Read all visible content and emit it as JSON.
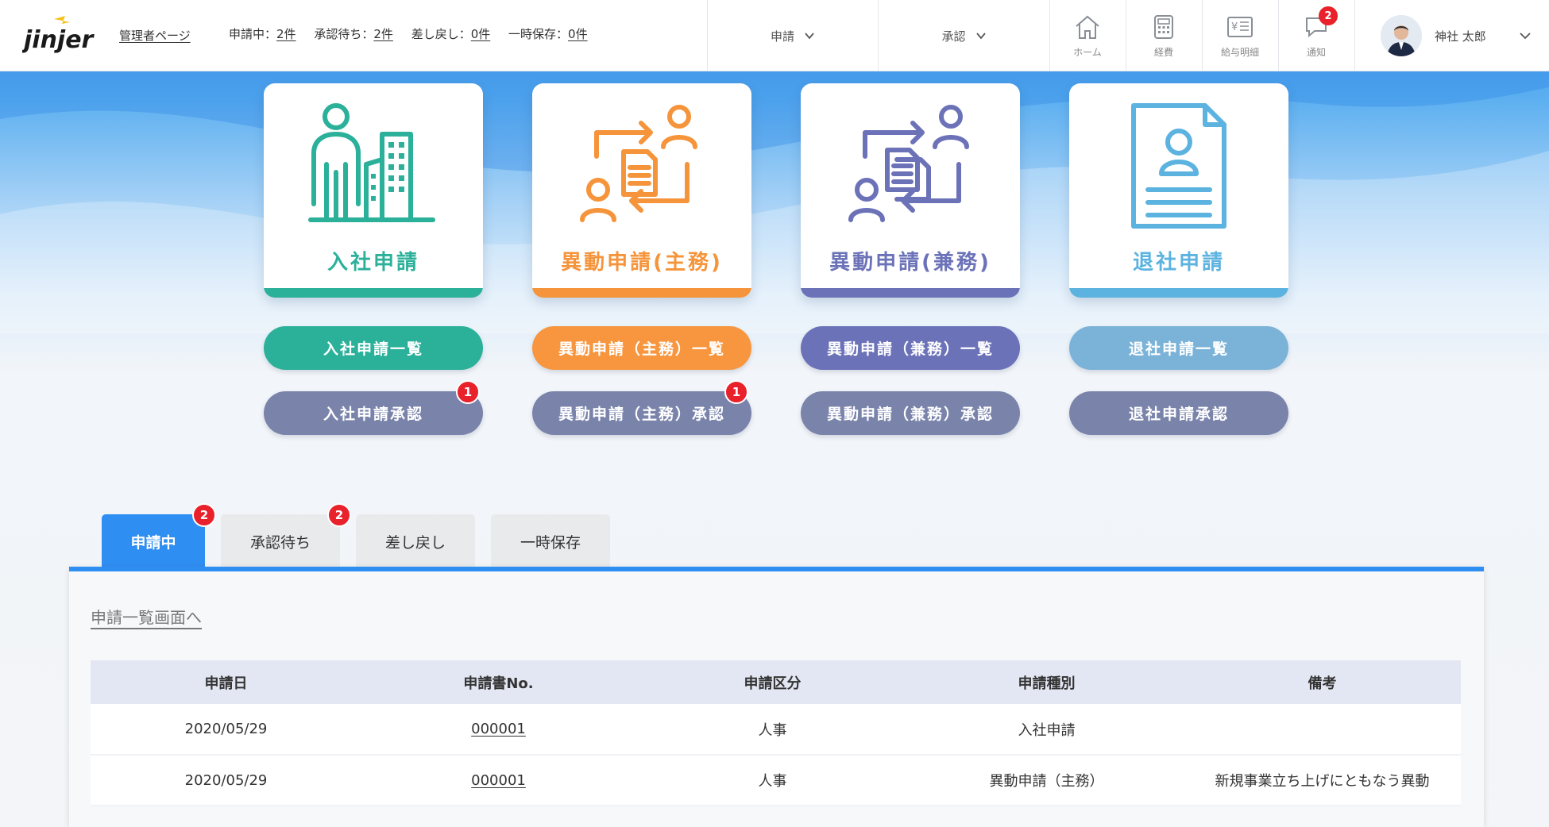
{
  "header": {
    "logo_text": "jinjer",
    "admin_link": "管理者ページ",
    "stats": [
      {
        "label": "申請中：",
        "value": "2件"
      },
      {
        "label": "承認待ち：",
        "value": "2件"
      },
      {
        "label": "差し戻し：",
        "value": "0件"
      },
      {
        "label": "一時保存：",
        "value": "0件"
      }
    ],
    "menus": [
      {
        "label": "申請",
        "icon": "chevron-down-icon"
      },
      {
        "label": "承認",
        "icon": "chevron-down-icon"
      }
    ],
    "icons": [
      {
        "label": "ホーム",
        "icon": "home-icon"
      },
      {
        "label": "経費",
        "icon": "calculator-icon"
      },
      {
        "label": "給与明細",
        "icon": "payslip-icon"
      },
      {
        "label": "通知",
        "icon": "chat-bubble-icon",
        "badge": "2"
      }
    ],
    "user": {
      "name": "神社 太郎"
    }
  },
  "cards": [
    {
      "title": "入社申請",
      "color": "#2bb09a",
      "list": "入社申請一覧",
      "approve": "入社申請承認",
      "approve_badge": "1",
      "list_color": "#2bb09a"
    },
    {
      "title": "異動申請(主務)",
      "color": "#f5943a",
      "list": "異動申請（主務）一覧",
      "approve": "異動申請（主務）承認",
      "approve_badge": "1",
      "list_color": "#f7963f"
    },
    {
      "title": "異動申請(兼務)",
      "color": "#6b72b8",
      "list": "異動申請（兼務）一覧",
      "approve": "異動申請（兼務）承認",
      "approve_badge": "",
      "list_color": "#6b72b8"
    },
    {
      "title": "退社申請",
      "color": "#5cb3e0",
      "list": "退社申請一覧",
      "approve": "退社申請承認",
      "approve_badge": "",
      "list_color": "#7bb3d8"
    }
  ],
  "approve_color": "#7a84ab",
  "tabs": [
    {
      "label": "申請中",
      "badge": "2",
      "active": true
    },
    {
      "label": "承認待ち",
      "badge": "2"
    },
    {
      "label": "差し戻し"
    },
    {
      "label": "一時保存"
    }
  ],
  "panel": {
    "link": "申請一覧画面へ",
    "columns": [
      "申請日",
      "申請書No.",
      "申請区分",
      "申請種別",
      "備考"
    ],
    "rows": [
      [
        "2020/05/29",
        "000001",
        "人事",
        "入社申請",
        ""
      ],
      [
        "2020/05/29",
        "000001",
        "人事",
        "異動申請（主務）",
        "新規事業立ち上げにともなう異動"
      ]
    ]
  },
  "colors": {
    "primary": "#2f8ef2",
    "badge": "#e8212b"
  }
}
